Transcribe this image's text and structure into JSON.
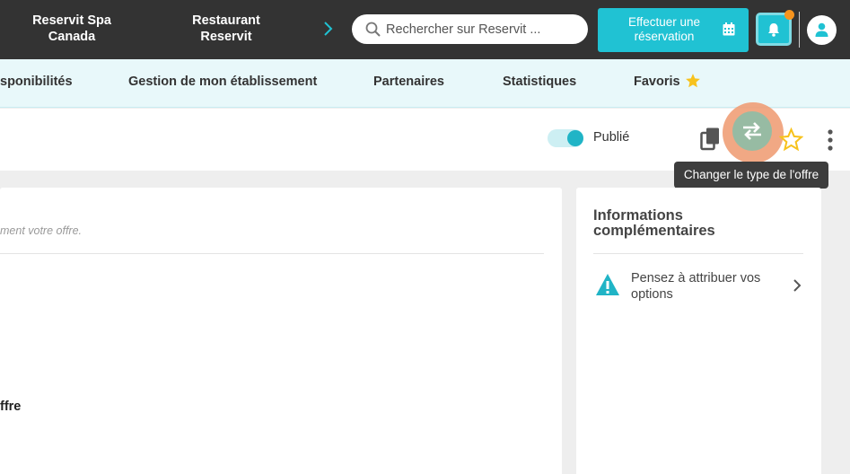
{
  "topbar": {
    "establishment_1": "Reservit Spa Canada",
    "establishment_2": "Restaurant Reservit",
    "search_placeholder": "Rechercher sur Reservit ...",
    "book_button": "Effectuer une réservation",
    "notification_dot_color": "#f7941d",
    "accent_color": "#20c2d3"
  },
  "nav": {
    "items": [
      "sponibilités",
      "Gestion de mon établissement",
      "Partenaires",
      "Statistiques",
      "Favoris"
    ]
  },
  "actionbar": {
    "published_label": "Publié",
    "published": true,
    "tooltip": "Changer le type de l'offre"
  },
  "main": {
    "hint": "ment votre offre.",
    "offer_label": "ffre"
  },
  "side": {
    "title": "Informations complémentaires",
    "warning_text": "Pensez à attribuer vos options"
  }
}
